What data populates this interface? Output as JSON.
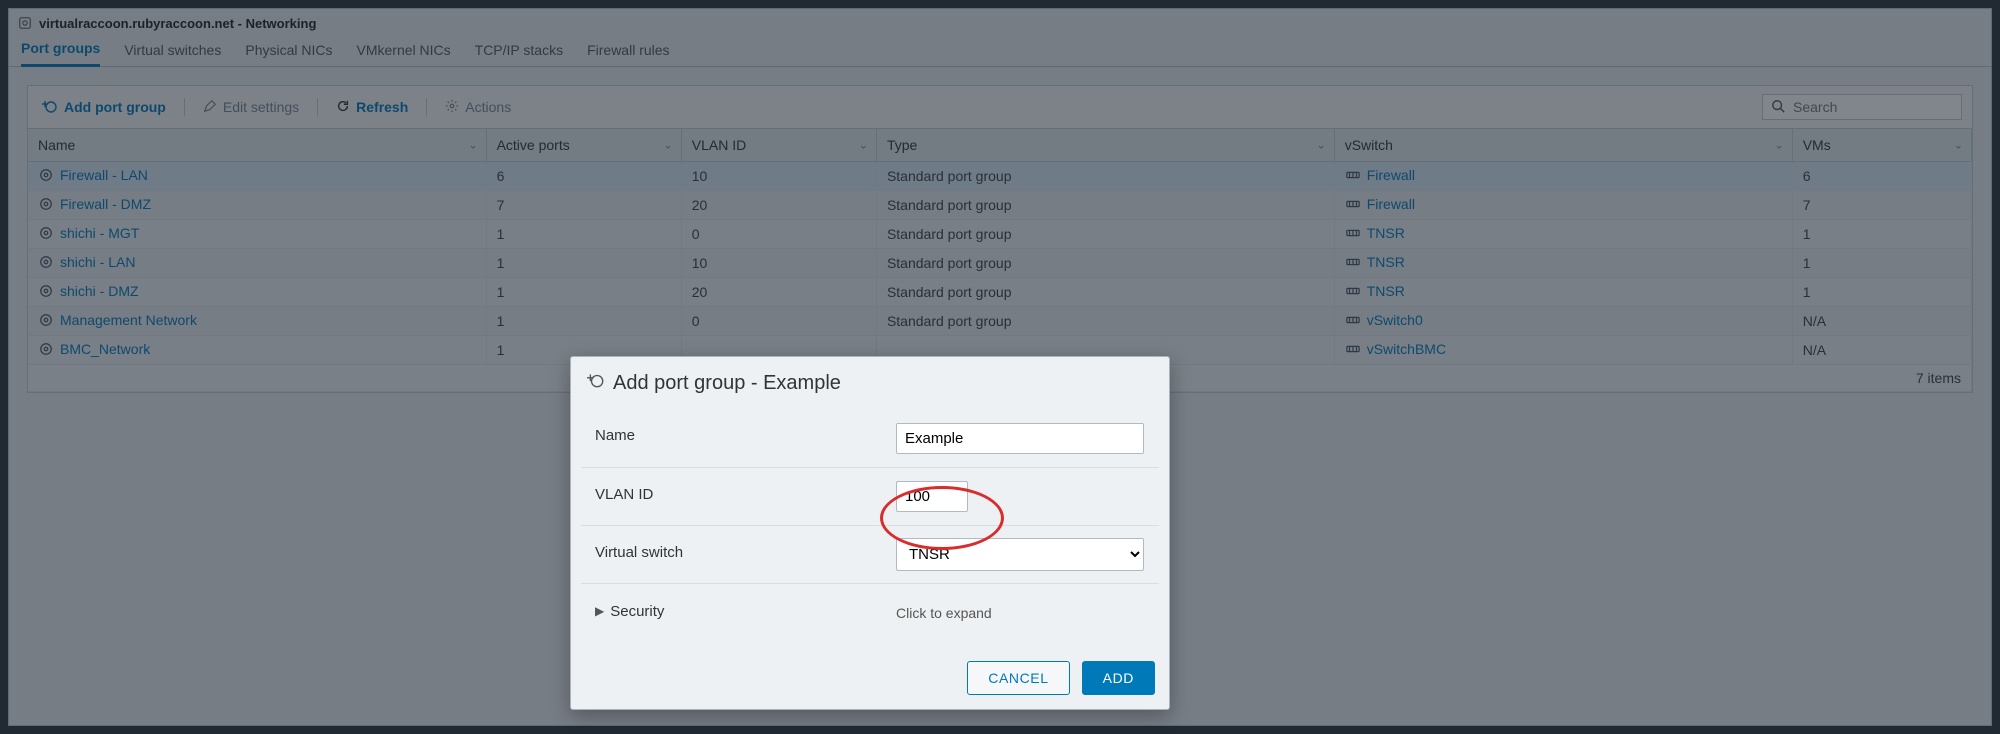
{
  "page_title": "virtualraccoon.rubyraccoon.net - Networking",
  "tabs": [
    {
      "label": "Port groups",
      "active": true
    },
    {
      "label": "Virtual switches",
      "active": false
    },
    {
      "label": "Physical NICs",
      "active": false
    },
    {
      "label": "VMkernel NICs",
      "active": false
    },
    {
      "label": "TCP/IP stacks",
      "active": false
    },
    {
      "label": "Firewall rules",
      "active": false
    }
  ],
  "toolbar": {
    "add": "Add port group",
    "edit": "Edit settings",
    "refresh": "Refresh",
    "actions": "Actions"
  },
  "search": {
    "placeholder": "Search"
  },
  "columns": [
    "Name",
    "Active ports",
    "VLAN ID",
    "Type",
    "vSwitch",
    "VMs"
  ],
  "rows": [
    {
      "name": "Firewall - LAN",
      "active_ports": "6",
      "vlan": "10",
      "type": "Standard port group",
      "vswitch": "Firewall",
      "vms": "6",
      "hl": true
    },
    {
      "name": "Firewall - DMZ",
      "active_ports": "7",
      "vlan": "20",
      "type": "Standard port group",
      "vswitch": "Firewall",
      "vms": "7",
      "hl": false
    },
    {
      "name": "shichi - MGT",
      "active_ports": "1",
      "vlan": "0",
      "type": "Standard port group",
      "vswitch": "TNSR",
      "vms": "1",
      "hl": false
    },
    {
      "name": "shichi - LAN",
      "active_ports": "1",
      "vlan": "10",
      "type": "Standard port group",
      "vswitch": "TNSR",
      "vms": "1",
      "hl": false
    },
    {
      "name": "shichi - DMZ",
      "active_ports": "1",
      "vlan": "20",
      "type": "Standard port group",
      "vswitch": "TNSR",
      "vms": "1",
      "hl": false
    },
    {
      "name": "Management Network",
      "active_ports": "1",
      "vlan": "0",
      "type": "Standard port group",
      "vswitch": "vSwitch0",
      "vms": "N/A",
      "hl": false
    },
    {
      "name": "BMC_Network",
      "active_ports": "1",
      "vlan": "",
      "type": "",
      "vswitch": "vSwitchBMC",
      "vms": "N/A",
      "hl": false
    }
  ],
  "footer": "7 items",
  "dialog": {
    "title": "Add port group - Example",
    "fields": {
      "name": {
        "label": "Name",
        "value": "Example"
      },
      "vlan": {
        "label": "VLAN ID",
        "value": "100"
      },
      "vswitch": {
        "label": "Virtual switch",
        "value": "TNSR"
      },
      "security": {
        "label": "Security",
        "hint": "Click to expand"
      }
    },
    "cancel": "CANCEL",
    "add": "ADD"
  }
}
